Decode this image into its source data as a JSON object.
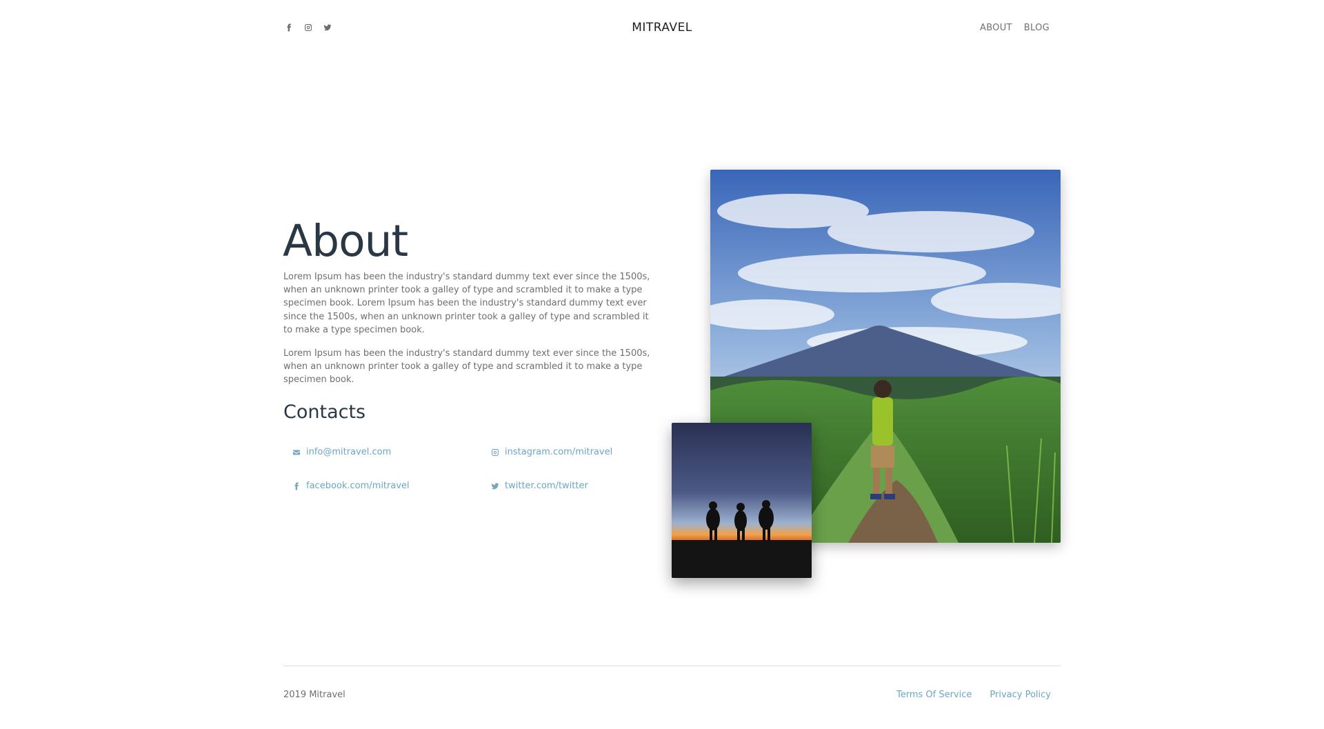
{
  "header": {
    "brand": "MITRAVEL",
    "social_icons": [
      "facebook-icon",
      "instagram-icon",
      "twitter-icon"
    ],
    "nav": [
      "ABOUT",
      "BLOG"
    ]
  },
  "about": {
    "title": "About",
    "paragraph1": "Lorem Ipsum has been the industry's standard dummy text ever since the 1500s, when an unknown printer took a galley of type and scrambled it to make a type specimen book. Lorem Ipsum has been the industry's standard dummy text ever since the 1500s, when an unknown printer took a galley of type and scrambled it to make a type specimen book.",
    "paragraph2": "Lorem Ipsum has been the industry's standard dummy text ever since the 1500s, when an unknown printer took a galley of type and scrambled it to make a type specimen book."
  },
  "contacts": {
    "title": "Contacts",
    "email": "info@mitravel.com",
    "instagram": "instagram.com/mitravel",
    "facebook": "facebook.com/mitravel",
    "twitter": "twitter.com/twitter"
  },
  "footer": {
    "copyright": "2019 Mitravel",
    "links": [
      "Terms Of Service",
      "Privacy Policy"
    ]
  },
  "colors": {
    "heading": "#2a3744",
    "link": "#6aa6c4",
    "text": "#6e6e6e"
  }
}
